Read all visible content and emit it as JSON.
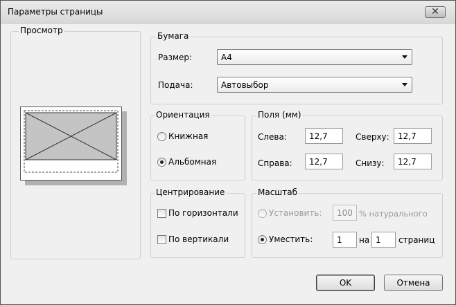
{
  "window": {
    "title": "Параметры страницы",
    "close_label": "✕"
  },
  "preview": {
    "label": "Просмотр"
  },
  "paper": {
    "label": "Бумага",
    "size_label": "Размер:",
    "size_value": "A4",
    "source_label": "Подача:",
    "source_value": "Автовыбор"
  },
  "orientation": {
    "label": "Ориентация",
    "portrait": "Книжная",
    "landscape": "Альбомная",
    "selected": "landscape"
  },
  "margins": {
    "label": "Поля (мм)",
    "left_label": "Слева:",
    "left_value": "12,7",
    "top_label": "Сверху:",
    "top_value": "12,7",
    "right_label": "Справа:",
    "right_value": "12,7",
    "bottom_label": "Снизу:",
    "bottom_value": "12,7"
  },
  "centering": {
    "label": "Центрирование",
    "horizontal": "По горизонтали",
    "vertical": "По вертикали"
  },
  "scale": {
    "label": "Масштаб",
    "set_label": "Установить:",
    "set_value": "100",
    "percent_label": "% натурального",
    "fit_label": "Уместить:",
    "fit_wide": "1",
    "on_label": "на",
    "fit_tall": "1",
    "pages_label": "страниц"
  },
  "buttons": {
    "ok": "OK",
    "cancel": "Отмена"
  }
}
